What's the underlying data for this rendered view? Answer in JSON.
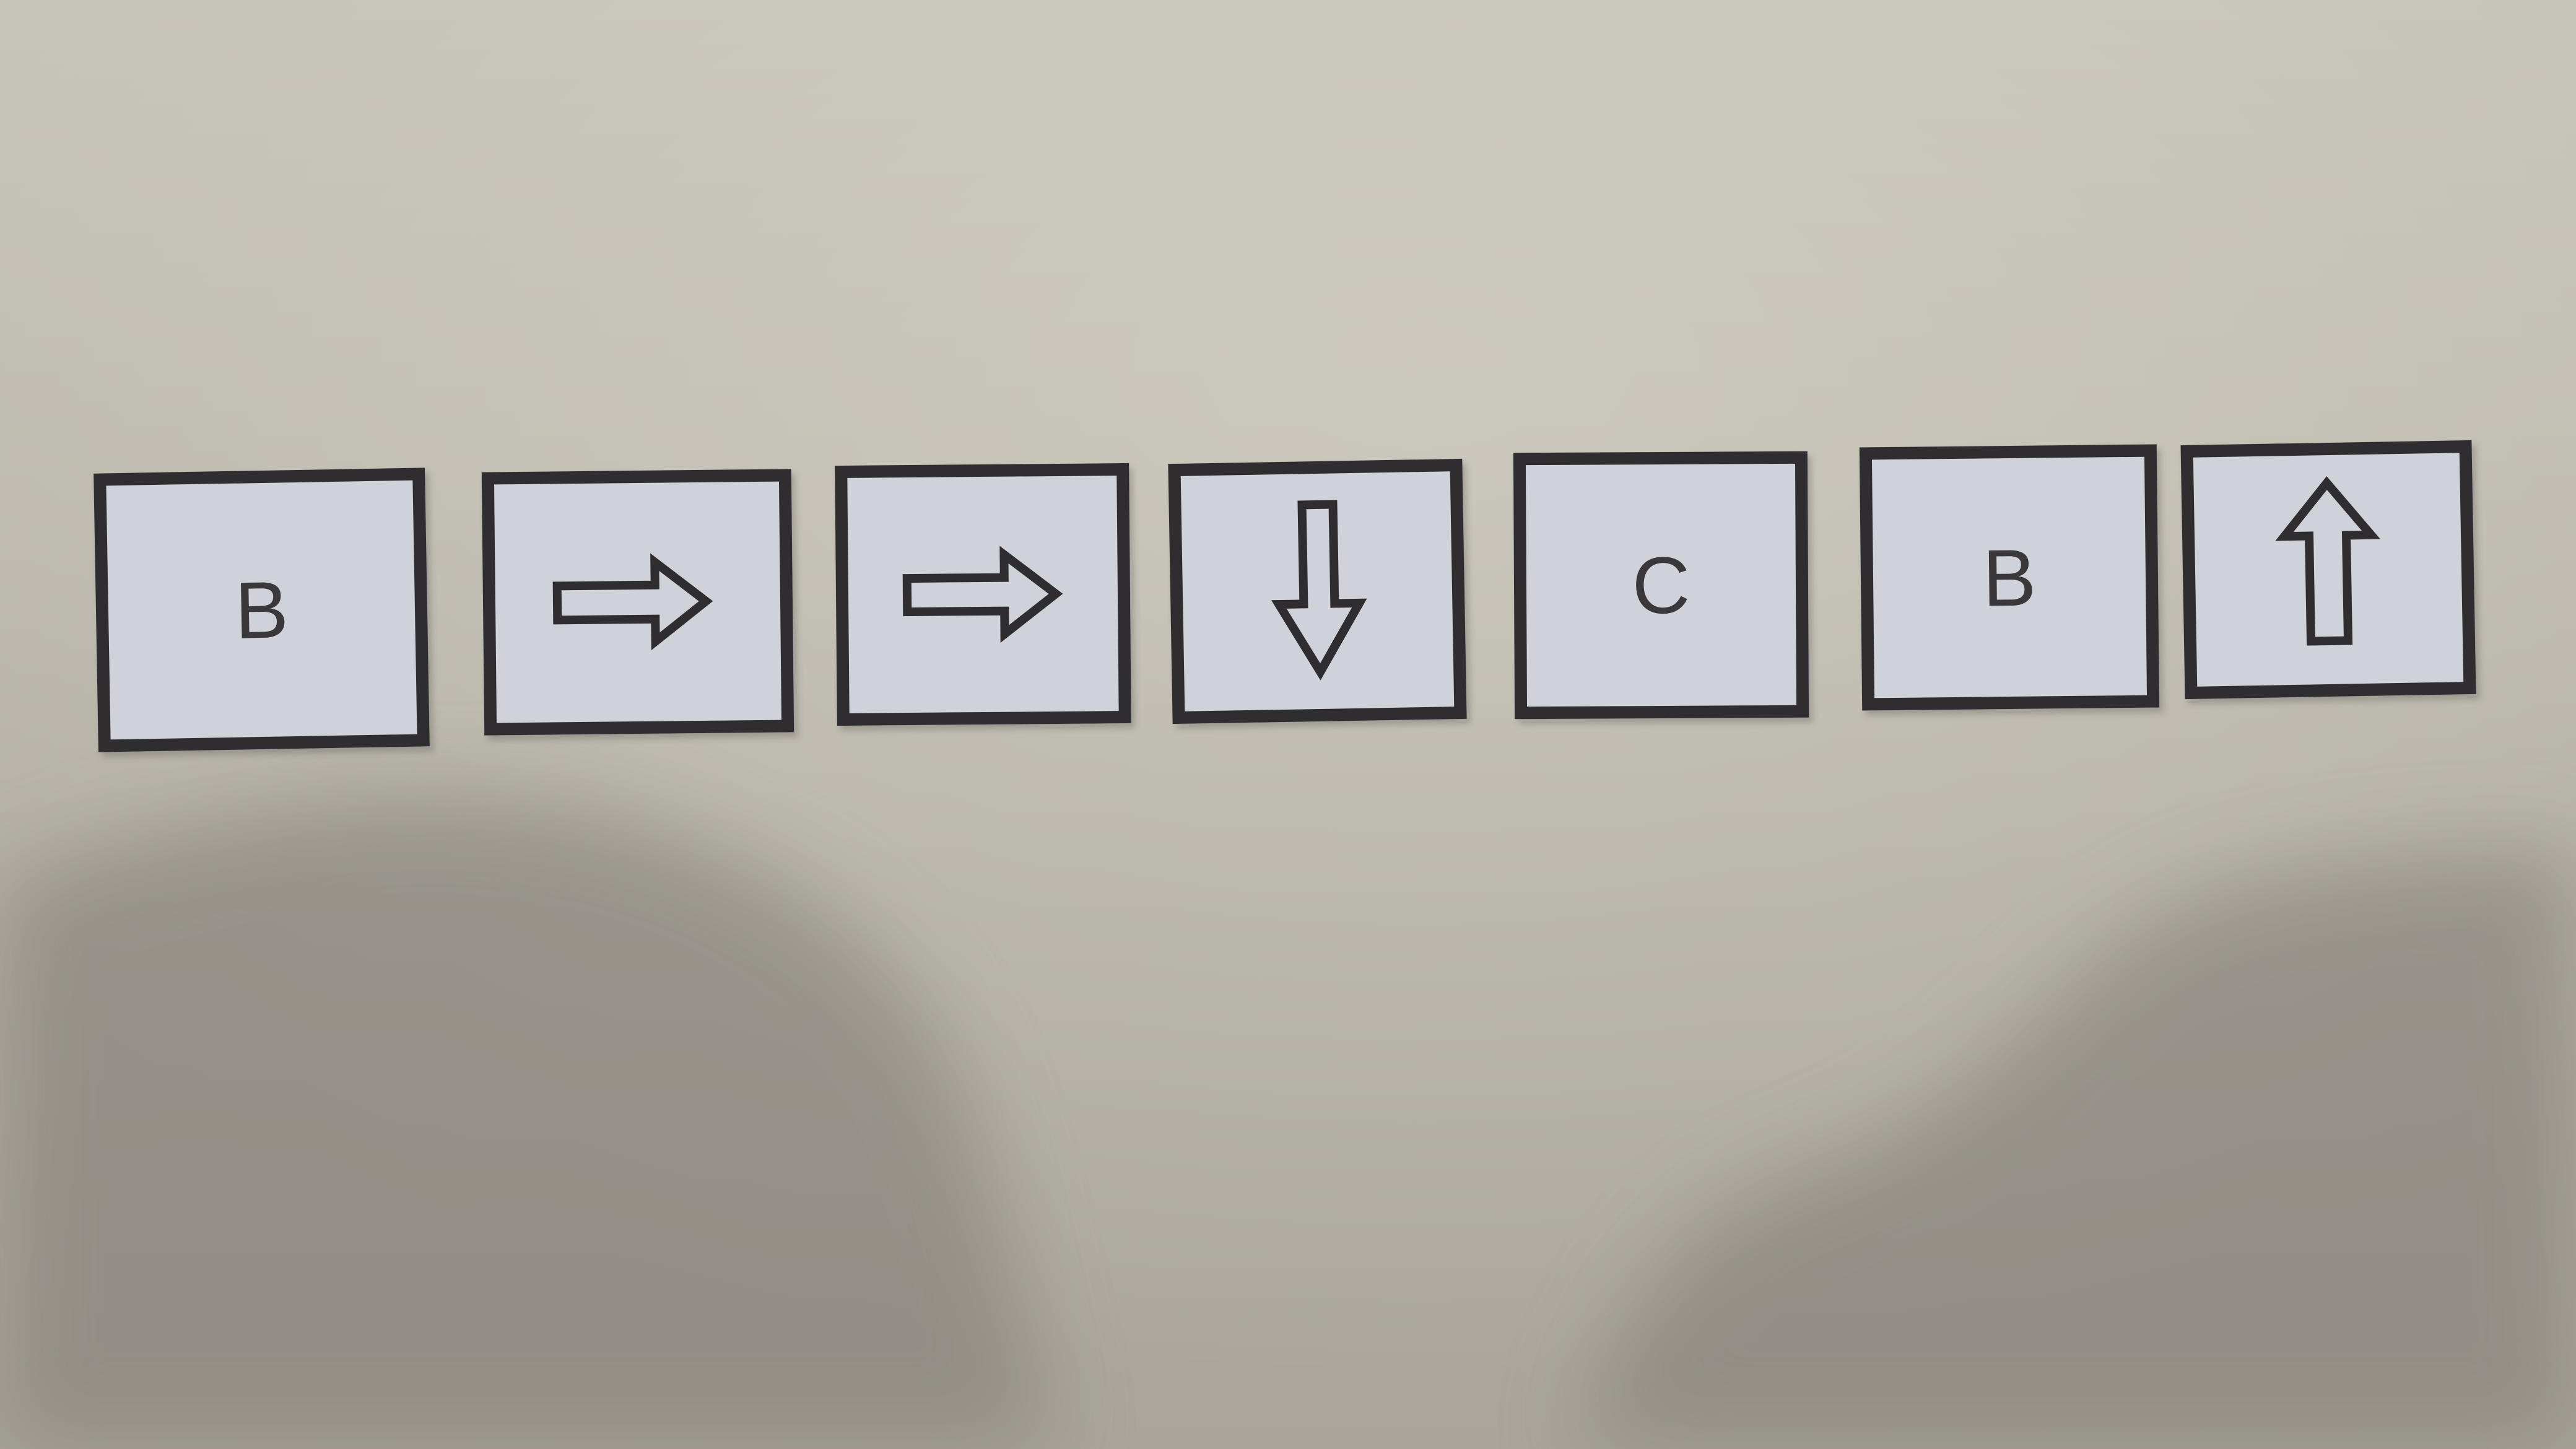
{
  "scene": {
    "description_free": true
  },
  "cards": [
    {
      "kind": "letter",
      "text": "B",
      "icon": ""
    },
    {
      "kind": "arrow",
      "text": "",
      "icon": "right-arrow-icon"
    },
    {
      "kind": "arrow",
      "text": "",
      "icon": "right-arrow-icon"
    },
    {
      "kind": "arrow",
      "text": "",
      "icon": "down-arrow-icon"
    },
    {
      "kind": "letter",
      "text": "C",
      "icon": ""
    },
    {
      "kind": "letter",
      "text": "B",
      "icon": ""
    },
    {
      "kind": "arrow",
      "text": "",
      "icon": "up-arrow-icon"
    }
  ],
  "colors": {
    "wall": "#bdb9ae",
    "card_fill": "#d0d2da",
    "card_border": "#2f2d30",
    "shadow": "#8f8a82"
  }
}
